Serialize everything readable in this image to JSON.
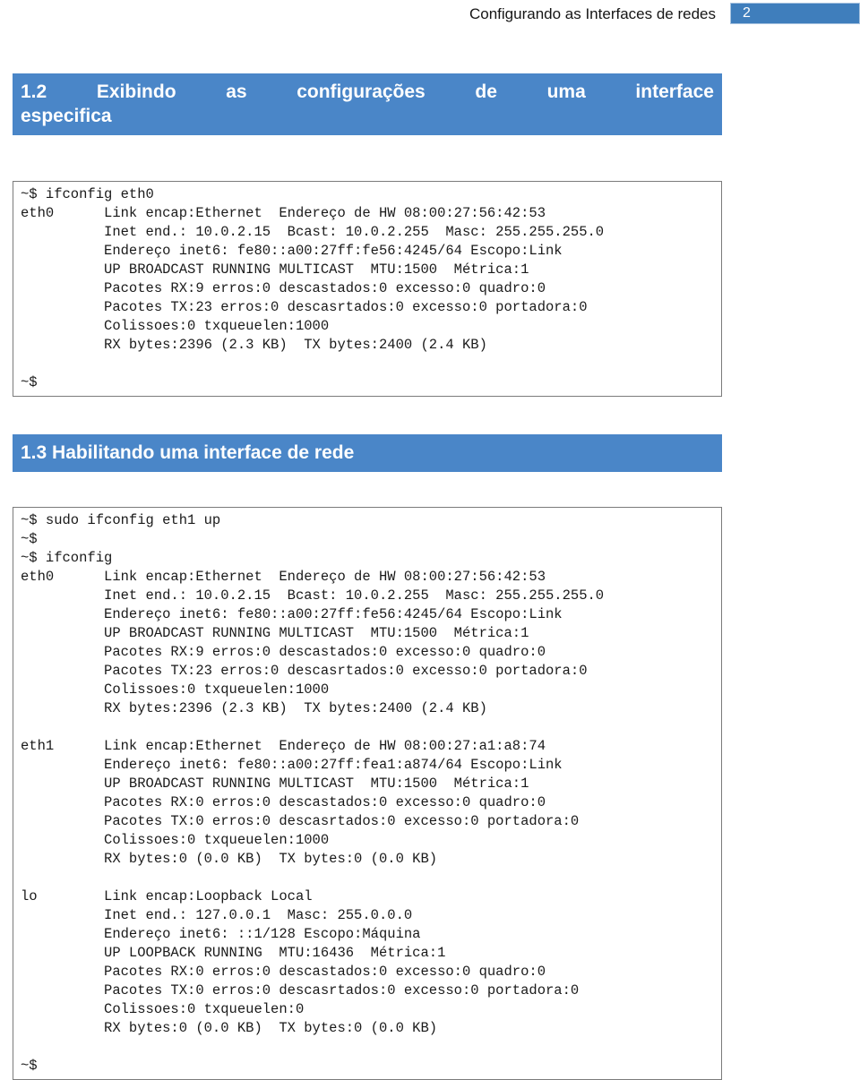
{
  "header": {
    "title": "Configurando as Interfaces de redes",
    "page_number": "2",
    "accent_color": "#3f7ebc"
  },
  "sections": [
    {
      "id": "1.2",
      "heading_lines": [
        [
          "1.2",
          "Exibindo",
          "as",
          "configurações",
          "de",
          "uma",
          "interface"
        ],
        [
          "especifica"
        ]
      ],
      "heading_plain": "1.2 Exibindo as configurações de uma interface especifica",
      "accent_color": "#4a86c8"
    },
    {
      "id": "1.3",
      "heading_lines": [
        [
          "1.3 Habilitando uma interface de rede"
        ]
      ],
      "heading_plain": "1.3 Habilitando uma interface de rede",
      "accent_color": "#4a86c8"
    }
  ],
  "code_blocks": [
    {
      "name": "ifconfig-eth0-output",
      "lines": [
        "~$ ifconfig eth0",
        "eth0      Link encap:Ethernet  Endereço de HW 08:00:27:56:42:53",
        "          Inet end.: 10.0.2.15  Bcast: 10.0.2.255  Masc: 255.255.255.0",
        "          Endereço inet6: fe80::a00:27ff:fe56:4245/64 Escopo:Link",
        "          UP BROADCAST RUNNING MULTICAST  MTU:1500  Métrica:1",
        "          Pacotes RX:9 erros:0 descastados:0 excesso:0 quadro:0",
        "          Pacotes TX:23 erros:0 descasrtados:0 excesso:0 portadora:0",
        "          Colissoes:0 txqueuelen:1000",
        "          RX bytes:2396 (2.3 KB)  TX bytes:2400 (2.4 KB)",
        "",
        "~$"
      ]
    },
    {
      "name": "ifconfig-all-output",
      "lines": [
        "~$ sudo ifconfig eth1 up",
        "~$",
        "~$ ifconfig",
        "eth0      Link encap:Ethernet  Endereço de HW 08:00:27:56:42:53",
        "          Inet end.: 10.0.2.15  Bcast: 10.0.2.255  Masc: 255.255.255.0",
        "          Endereço inet6: fe80::a00:27ff:fe56:4245/64 Escopo:Link",
        "          UP BROADCAST RUNNING MULTICAST  MTU:1500  Métrica:1",
        "          Pacotes RX:9 erros:0 descastados:0 excesso:0 quadro:0",
        "          Pacotes TX:23 erros:0 descasrtados:0 excesso:0 portadora:0",
        "          Colissoes:0 txqueuelen:1000",
        "          RX bytes:2396 (2.3 KB)  TX bytes:2400 (2.4 KB)",
        "",
        "eth1      Link encap:Ethernet  Endereço de HW 08:00:27:a1:a8:74",
        "          Endereço inet6: fe80::a00:27ff:fea1:a874/64 Escopo:Link",
        "          UP BROADCAST RUNNING MULTICAST  MTU:1500  Métrica:1",
        "          Pacotes RX:0 erros:0 descastados:0 excesso:0 quadro:0",
        "          Pacotes TX:0 erros:0 descasrtados:0 excesso:0 portadora:0",
        "          Colissoes:0 txqueuelen:1000",
        "          RX bytes:0 (0.0 KB)  TX bytes:0 (0.0 KB)",
        "",
        "lo        Link encap:Loopback Local",
        "          Inet end.: 127.0.0.1  Masc: 255.0.0.0",
        "          Endereço inet6: ::1/128 Escopo:Máquina",
        "          UP LOOPBACK RUNNING  MTU:16436  Métrica:1",
        "          Pacotes RX:0 erros:0 descastados:0 excesso:0 quadro:0",
        "          Pacotes TX:0 erros:0 descasrtados:0 excesso:0 portadora:0",
        "          Colissoes:0 txqueuelen:0",
        "          RX bytes:0 (0.0 KB)  TX bytes:0 (0.0 KB)",
        "",
        "~$"
      ]
    }
  ]
}
